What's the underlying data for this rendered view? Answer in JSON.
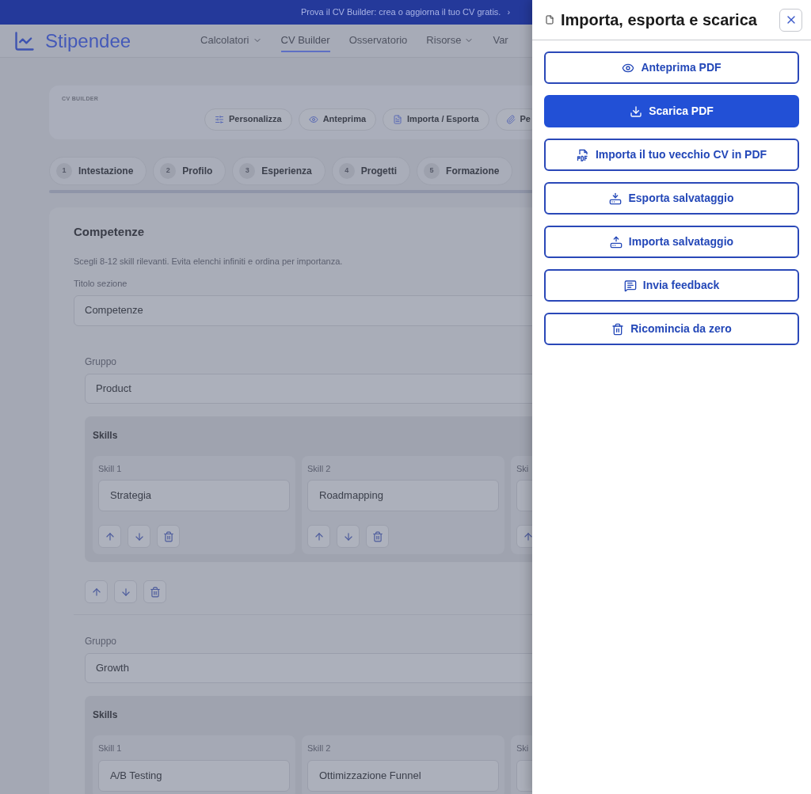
{
  "banner": {
    "text": "Prova il CV Builder: crea o aggiorna il tuo CV gratis.",
    "arrow": "›"
  },
  "header": {
    "logo": "Stipendee",
    "nav": [
      {
        "label": "Calcolatori",
        "dropdown": true,
        "selected": false
      },
      {
        "label": "CV Builder",
        "dropdown": false,
        "selected": true
      },
      {
        "label": "Osservatorio",
        "dropdown": false,
        "selected": false
      },
      {
        "label": "Risorse",
        "dropdown": true,
        "selected": false
      },
      {
        "label": "Var",
        "dropdown": false,
        "selected": false
      }
    ]
  },
  "cv_builder": {
    "label": "CV BUILDER",
    "actions": [
      {
        "label": "Personalizza"
      },
      {
        "label": "Anteprima"
      },
      {
        "label": "Importa / Esporta"
      },
      {
        "label": "Pe"
      }
    ]
  },
  "steps": [
    {
      "number": "1",
      "label": "Intestazione"
    },
    {
      "number": "2",
      "label": "Profilo"
    },
    {
      "number": "3",
      "label": "Esperienza"
    },
    {
      "number": "4",
      "label": "Progetti"
    },
    {
      "number": "5",
      "label": "Formazione"
    }
  ],
  "section": {
    "title": "Competenze",
    "description": "Scegli 8-12 skill rilevanti. Evita elenchi infiniti e ordina per importanza.",
    "title_label": "Titolo sezione",
    "title_value": "Competenze",
    "groups": [
      {
        "label": "Gruppo",
        "value": "Product",
        "skills_label": "Skills",
        "skills": [
          {
            "label": "Skill 1",
            "value": "Strategia"
          },
          {
            "label": "Skill 2",
            "value": "Roadmapping"
          },
          {
            "label": "Ski"
          }
        ]
      },
      {
        "label": "Gruppo",
        "value": "Growth",
        "skills_label": "Skills",
        "skills": [
          {
            "label": "Skill 1",
            "value": "A/B Testing"
          },
          {
            "label": "Skill 2",
            "value": "Ottimizzazione Funnel"
          },
          {
            "label": "Ski"
          }
        ]
      }
    ]
  },
  "drawer": {
    "title": "Importa, esporta e scarica",
    "actions": [
      {
        "label": "Anteprima PDF",
        "primary": false
      },
      {
        "label": "Scarica PDF",
        "primary": true
      },
      {
        "label": "Importa il tuo vecchio CV in PDF",
        "primary": false
      },
      {
        "label": "Esporta salvataggio",
        "primary": false
      },
      {
        "label": "Importa salvataggio",
        "primary": false
      },
      {
        "label": "Invia feedback",
        "primary": false
      },
      {
        "label": "Ricomincia da zero",
        "primary": false
      }
    ]
  }
}
